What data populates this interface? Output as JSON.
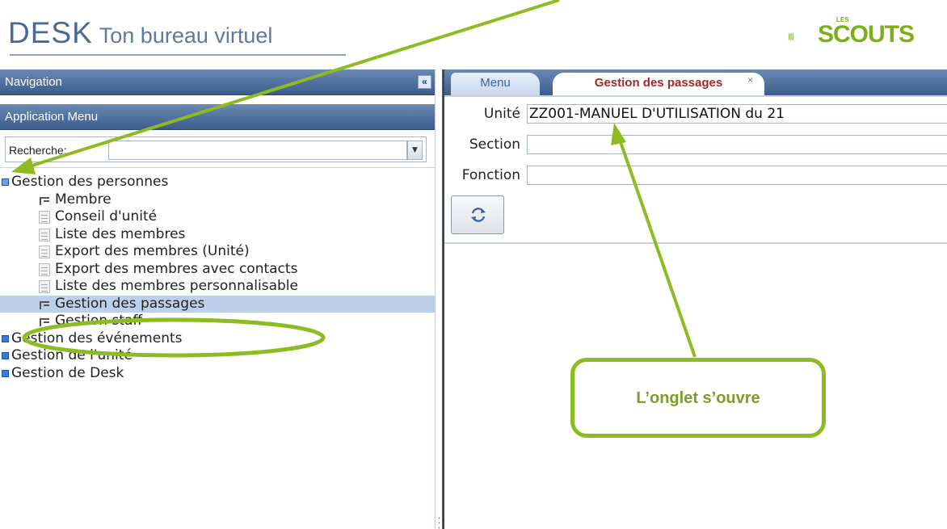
{
  "header": {
    "app_name": "DESK",
    "app_tagline": "Ton bureau virtuel",
    "logo_small": "LES",
    "logo_main": "SCOUTS"
  },
  "navigation": {
    "title": "Navigation",
    "collapse_symbol": "«",
    "app_menu_title": "Application Menu",
    "search_label": "Recherche:",
    "search_value": "",
    "dropdown_symbol": "▼"
  },
  "tree": {
    "groups": [
      {
        "label": "Gestion des personnes",
        "expanded": true,
        "items": [
          {
            "label": "Membre",
            "icon": "module-icon"
          },
          {
            "label": "Conseil d'unité",
            "icon": "document-icon"
          },
          {
            "label": "Liste des membres",
            "icon": "document-icon"
          },
          {
            "label": "Export des membres (Unité)",
            "icon": "document-icon"
          },
          {
            "label": "Export des membres avec contacts",
            "icon": "document-icon"
          },
          {
            "label": "Liste des membres personnalisable",
            "icon": "document-icon"
          },
          {
            "label": "Gestion des passages",
            "icon": "module-icon",
            "selected": true
          },
          {
            "label": "Gestion staff",
            "icon": "module-icon"
          }
        ]
      },
      {
        "label": "Gestion des événements",
        "expanded": false
      },
      {
        "label": "Gestion de l'unité",
        "expanded": false
      },
      {
        "label": "Gestion de Desk",
        "expanded": false
      }
    ]
  },
  "tabs": [
    {
      "label": "Menu",
      "active": false
    },
    {
      "label": "Gestion des passages",
      "active": true,
      "close_symbol": "×"
    }
  ],
  "form": {
    "unite_label": "Unité",
    "unite_value": "ZZ001-MANUEL D'UTILISATION du 21",
    "section_label": "Section",
    "section_value": "",
    "fonction_label": "Fonction",
    "fonction_value": ""
  },
  "annotation": {
    "callout_text": "L’onglet s’ouvre"
  },
  "colors": {
    "brand_blue": "#4a6a95",
    "scouts_green": "#7cae1a",
    "annotation_green": "#8dbb22",
    "active_tab_text": "#a02a2a",
    "selected_row": "#bcd0ec"
  }
}
